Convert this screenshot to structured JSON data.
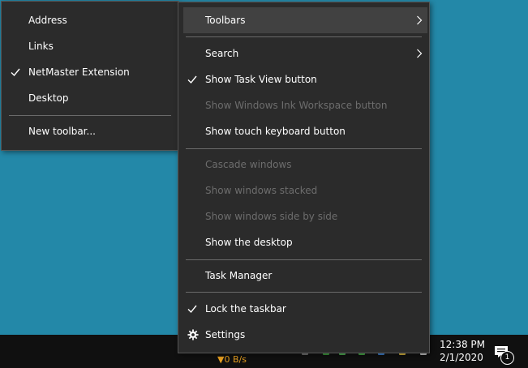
{
  "submenu": {
    "items": [
      {
        "label": "Address",
        "checked": false
      },
      {
        "label": "Links",
        "checked": false
      },
      {
        "label": "NetMaster Extension",
        "checked": true
      },
      {
        "label": "Desktop",
        "checked": false
      },
      {
        "label": "New toolbar...",
        "checked": false
      }
    ]
  },
  "menu": {
    "toolbars": "Toolbars",
    "search": "Search",
    "show_task_view": "Show Task View button",
    "show_ink_workspace": "Show Windows Ink Workspace button",
    "show_touch_keyboard": "Show touch keyboard button",
    "cascade": "Cascade windows",
    "stacked": "Show windows stacked",
    "side_by_side": "Show windows side by side",
    "show_desktop": "Show the desktop",
    "task_manager": "Task Manager",
    "lock_taskbar": "Lock the taskbar",
    "settings": "Settings"
  },
  "taskbar": {
    "net_speed": "▼0 B/s",
    "time": "12:38 PM",
    "date": "2/1/2020",
    "notification_count": "1"
  },
  "colors": {
    "desktop": "#2388a8",
    "menu_bg": "#2b2b2b",
    "highlight": "#414141",
    "disabled_text": "#6d6d6d",
    "taskbar": "#101010",
    "net_speed": "#e8a020"
  }
}
